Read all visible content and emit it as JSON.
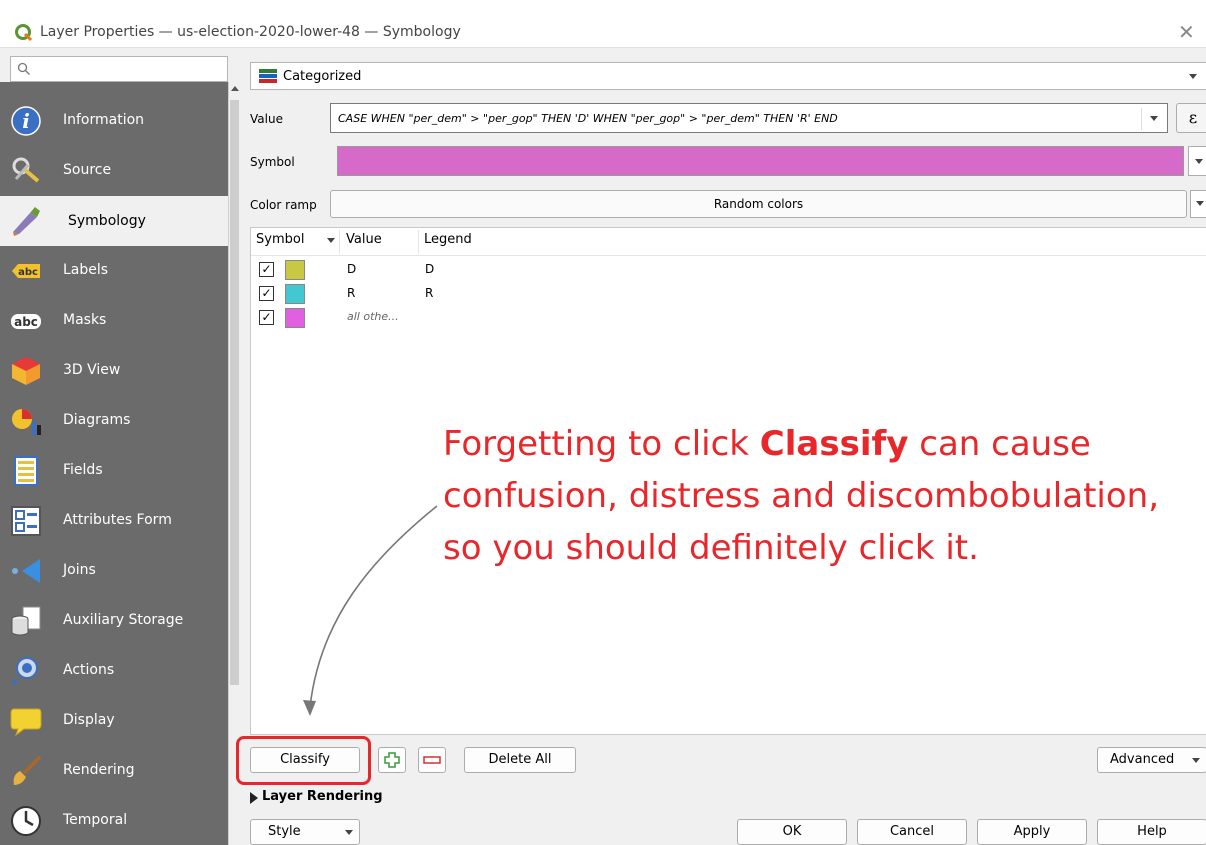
{
  "window": {
    "title": "Layer Properties — us-election-2020-lower-48 — Symbology",
    "close_glyph": "✕"
  },
  "sidebar": {
    "search_placeholder": "",
    "selected": "Symbology",
    "items": [
      {
        "label": "Information",
        "icon": "information-icon"
      },
      {
        "label": "Source",
        "icon": "source-icon"
      },
      {
        "label": "Symbology",
        "icon": "symbology-icon"
      },
      {
        "label": "Labels",
        "icon": "labels-icon"
      },
      {
        "label": "Masks",
        "icon": "masks-icon"
      },
      {
        "label": "3D View",
        "icon": "3d-view-icon"
      },
      {
        "label": "Diagrams",
        "icon": "diagrams-icon"
      },
      {
        "label": "Fields",
        "icon": "fields-icon"
      },
      {
        "label": "Attributes Form",
        "icon": "attributes-form-icon"
      },
      {
        "label": "Joins",
        "icon": "joins-icon"
      },
      {
        "label": "Auxiliary Storage",
        "icon": "auxiliary-storage-icon"
      },
      {
        "label": "Actions",
        "icon": "actions-icon"
      },
      {
        "label": "Display",
        "icon": "display-icon"
      },
      {
        "label": "Rendering",
        "icon": "rendering-icon"
      },
      {
        "label": "Temporal",
        "icon": "temporal-icon"
      }
    ]
  },
  "renderer": {
    "selected": "Categorized"
  },
  "value": {
    "label": "Value",
    "expression": "CASE   WHEN  \"per_dem\" > \"per_gop\" THEN 'D'  WHEN  \"per_gop\" > \"per_dem\" THEN 'R'   END",
    "expression_button": "ε"
  },
  "symbol": {
    "label": "Symbol",
    "color": "#d66ac8"
  },
  "color_ramp": {
    "label": "Color ramp",
    "value": "Random colors"
  },
  "classes": {
    "headers": {
      "symbol": "Symbol",
      "value": "Value",
      "legend": "Legend"
    },
    "check_glyph": "✓",
    "rows": [
      {
        "checked": true,
        "color": "#c8c844",
        "value": "D",
        "legend": "D"
      },
      {
        "checked": true,
        "color": "#44c8d0",
        "value": "R",
        "legend": "R"
      },
      {
        "checked": true,
        "color": "#e060e0",
        "value": "all othe...",
        "legend": ""
      }
    ]
  },
  "annotation": {
    "text_before": "Forgetting to click ",
    "text_bold": "Classify",
    "text_after": " can cause confusion, distress and discombobulation, so you should definitely click it.",
    "color": "#e8272a"
  },
  "actions": {
    "classify": "Classify",
    "delete_all": "Delete All",
    "advanced": "Advanced",
    "layer_rendering": "Layer Rendering"
  },
  "footer": {
    "style": "Style",
    "ok": "OK",
    "cancel": "Cancel",
    "apply": "Apply",
    "help": "Help"
  }
}
